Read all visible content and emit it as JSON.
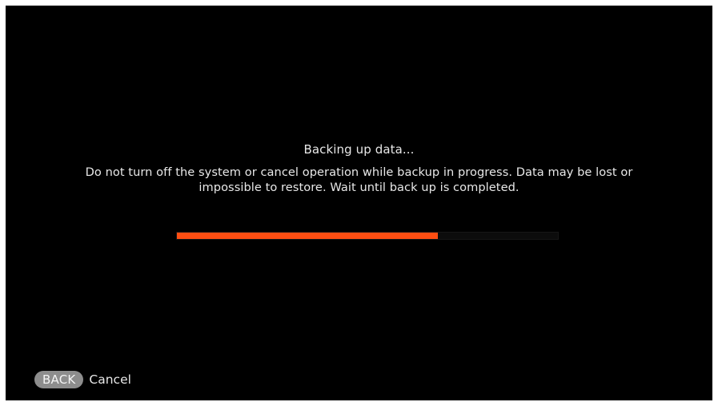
{
  "status": {
    "title": "Backing up data...",
    "warning": "Do not turn off the system or cancel operation while backup in progress. Data may be lost or impossible to restore. Wait until back up is completed."
  },
  "progress": {
    "percent": 68.5,
    "fill_color": "#ff4e12"
  },
  "footer": {
    "back_label": "BACK",
    "cancel_label": "Cancel"
  }
}
